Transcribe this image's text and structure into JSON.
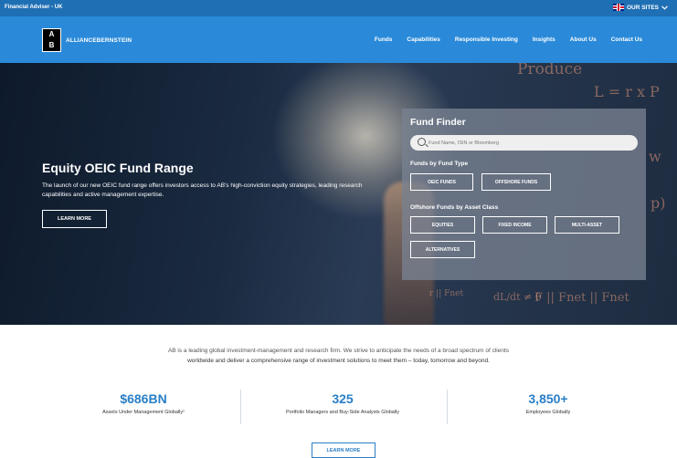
{
  "topbar": {
    "audience": "Financial Adviser - UK",
    "our_sites": "OUR SITES"
  },
  "brand": {
    "logo_top": "A",
    "logo_bottom": "B",
    "name": "ALLIANCEBERNSTEIN"
  },
  "nav": {
    "items": [
      "Funds",
      "Capabilities",
      "Responsible Investing",
      "Insights",
      "About Us",
      "Contact Us"
    ]
  },
  "hero": {
    "title": "Equity OEIC Fund Range",
    "description": "The launch of our new OEIC fund range offers investors access to AB's high-conviction equity strategies, leading research capabilities and active management expertise.",
    "cta": "LEARN MORE",
    "formulas": [
      "Produce",
      "L = r x P",
      "w",
      "p)",
      "dL/dt ≠ 0",
      "F || Fnet || Fnet",
      "r || Fnet"
    ]
  },
  "fund_finder": {
    "title": "Fund Finder",
    "search_placeholder": "Fund Name, ISIN or Bloomberg",
    "by_type_heading": "Funds by Fund Type",
    "by_type": [
      "OEIC FUNDS",
      "OFFSHORE FUNDS"
    ],
    "by_asset_heading": "Offshore Funds by Asset Class",
    "by_asset": [
      "EQUITIES",
      "FIXED INCOME",
      "MULTI-ASSET",
      "ALTERNATIVES"
    ]
  },
  "about": {
    "line1": "AB is a leading global investment-management and research firm. We strive to anticipate the needs of a broad spectrum of clients",
    "line2": "worldwide and deliver a comprehensive range of investment solutions to meet them – today, tomorrow and beyond."
  },
  "stats": [
    {
      "value": "$686BN",
      "label": "Assets Under Management Globally¹"
    },
    {
      "value": "325",
      "label": "Portfolio Managers and Buy-Side Analysts Globally"
    },
    {
      "value": "3,850+",
      "label": "Employees Globally"
    }
  ],
  "footer_cta": "LEARN MORE",
  "colors": {
    "topbar": "#1f6fb4",
    "navbar": "#2a8ad9",
    "accent": "#2a7fc6"
  }
}
